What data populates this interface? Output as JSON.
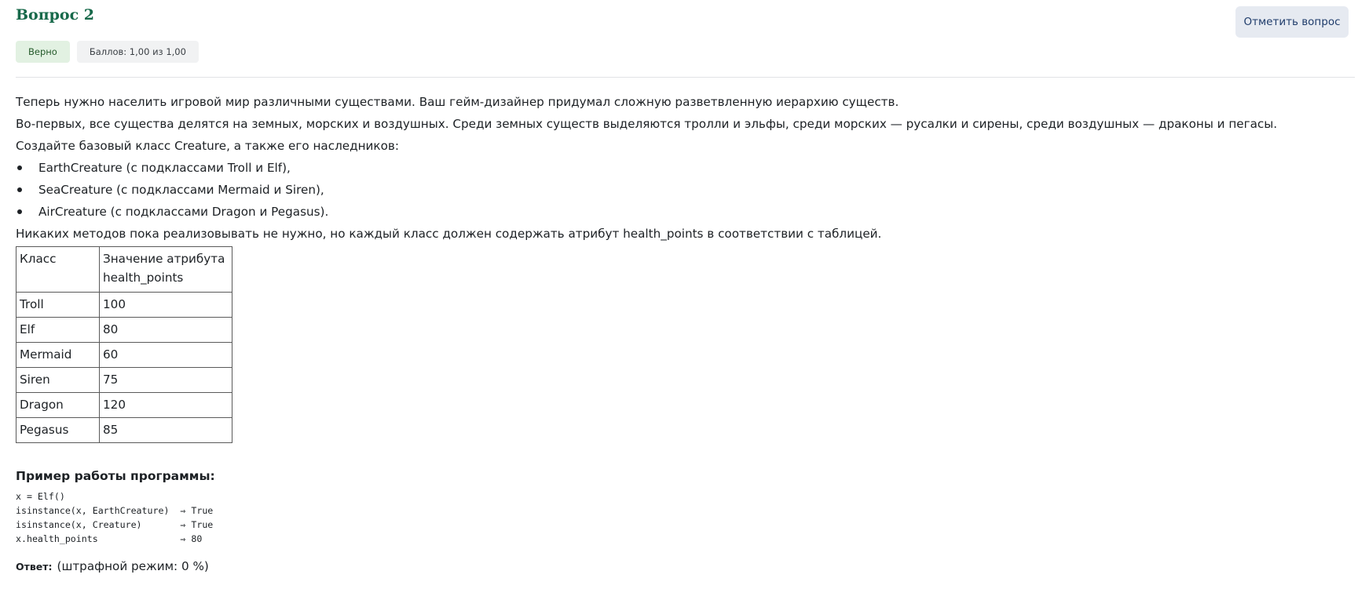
{
  "question": {
    "title": "Вопрос 2",
    "flag_button": "Отметить вопрос",
    "status_badge": "Верно",
    "score_badge": "Баллов: 1,00 из 1,00"
  },
  "content": {
    "paragraphs": [
      "Теперь нужно населить игровой мир различными существами. Ваш гейм-дизайнер придумал сложную разветвленную иерархию существ.",
      "Во-первых, все существа делятся на земных, морских и воздушных. Среди земных существ выделяются тролли и эльфы, среди морских — русалки и сирены, среди воздушных — драконы и пегасы.",
      "Создайте базовый класс Creature, а также его наследников:"
    ],
    "bullets": [
      "EarthCreature (с подклассами Troll и Elf),",
      "SeaCreature (с подклассами Mermaid и Siren),",
      "AirCreature (с подклассами Dragon и Pegasus)."
    ],
    "after_list": "Никаких методов пока реализовывать не нужно, но каждый класс должен содержать атрибут health_points в соответствии с таблицей."
  },
  "table": {
    "header": {
      "col1": "Класс",
      "col2_line1": "Значение атрибута",
      "col2_line2": "health_points"
    },
    "rows": [
      {
        "cls": "Troll",
        "hp": "100"
      },
      {
        "cls": "Elf",
        "hp": "80"
      },
      {
        "cls": "Mermaid",
        "hp": "60"
      },
      {
        "cls": "Siren",
        "hp": "75"
      },
      {
        "cls": "Dragon",
        "hp": "120"
      },
      {
        "cls": "Pegasus",
        "hp": "85"
      }
    ]
  },
  "example": {
    "title": "Пример работы программы:",
    "code_lines": [
      "x = Elf()",
      "isinstance(x, EarthCreature)  ⇒ True",
      "isinstance(x, Creature)       ⇒ True",
      "x.health_points               ⇒ 80"
    ]
  },
  "answer": {
    "label": "Ответ:",
    "text": "(штрафной режим: 0 %)"
  }
}
